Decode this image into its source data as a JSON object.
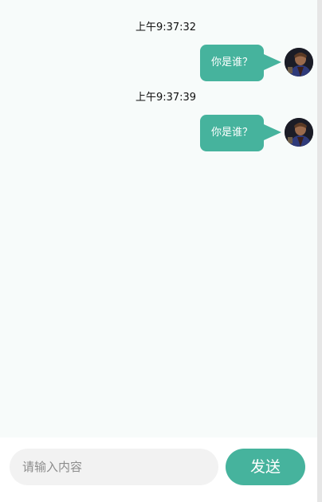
{
  "messages": [
    {
      "time": "上午9:37:32",
      "text": "你是谁？"
    },
    {
      "time": "上午9:37:39",
      "text": "你是谁？"
    }
  ],
  "composer": {
    "placeholder": "请输入内容",
    "value": "",
    "send_label": "发送"
  },
  "colors": {
    "accent": "#46b39d",
    "chat_background": "#f7fbfa",
    "input_background": "#f2f2f2"
  },
  "icons": {
    "avatar": "user-avatar-photo"
  }
}
